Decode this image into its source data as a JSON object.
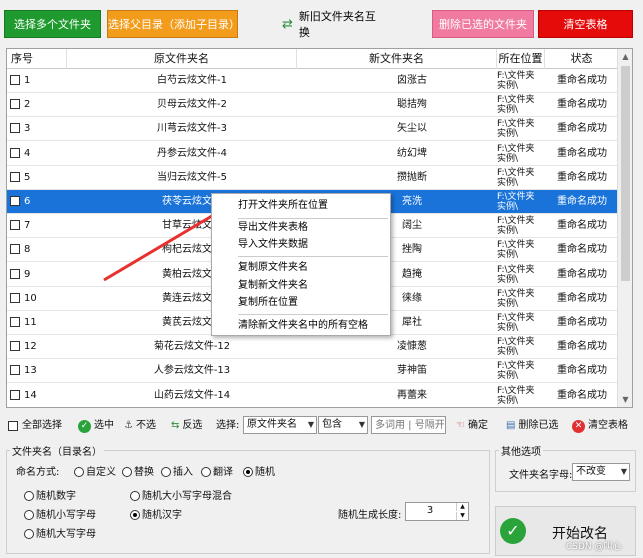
{
  "top_buttons": {
    "select_folders": "选择多个文件夹",
    "select_parent": "选择父目录（添加子目录）",
    "swap": "新旧文件夹名互换",
    "delete_selected": "删除已选的文件夹",
    "clear_table": "清空表格"
  },
  "table": {
    "columns": [
      "序号",
      "原文件夹名",
      "新文件夹名",
      "所在位置",
      "状态"
    ],
    "rows": [
      {
        "idx": "1",
        "old": "白芍云炫文件-1",
        "new": "囟涨古",
        "loc": "F:\\文件夹实例\\",
        "status": "重命名成功"
      },
      {
        "idx": "2",
        "old": "贝母云炫文件-2",
        "new": "聪拮殉",
        "loc": "F:\\文件夹实例\\",
        "status": "重命名成功"
      },
      {
        "idx": "3",
        "old": "川芎云炫文件-3",
        "new": "矢尘以",
        "loc": "F:\\文件夹实例\\",
        "status": "重命名成功"
      },
      {
        "idx": "4",
        "old": "丹参云炫文件-4",
        "new": "纺幻埤",
        "loc": "F:\\文件夹实例\\",
        "status": "重命名成功"
      },
      {
        "idx": "5",
        "old": "当归云炫文件-5",
        "new": "攒抛断",
        "loc": "F:\\文件夹实例\\",
        "status": "重命名成功"
      },
      {
        "idx": "6",
        "old": "茯苓云炫文件",
        "new": "亮洗",
        "loc": "F:\\文件夹实例\\",
        "status": "重命名成功"
      },
      {
        "idx": "7",
        "old": "甘草云炫文件",
        "new": "阔尘",
        "loc": "F:\\文件夹实例\\",
        "status": "重命名成功"
      },
      {
        "idx": "8",
        "old": "枸杞云炫文件",
        "new": "挫陶",
        "loc": "F:\\文件夹实例\\",
        "status": "重命名成功"
      },
      {
        "idx": "9",
        "old": "黄柏云炫文件",
        "new": "趋掩",
        "loc": "F:\\文件夹实例\\",
        "status": "重命名成功"
      },
      {
        "idx": "10",
        "old": "黄连云炫文件",
        "new": "徕缘",
        "loc": "F:\\文件夹实例\\",
        "status": "重命名成功"
      },
      {
        "idx": "11",
        "old": "黄芪云炫文件",
        "new": "犀社",
        "loc": "F:\\文件夹实例\\",
        "status": "重命名成功"
      },
      {
        "idx": "12",
        "old": "菊花云炫文件-12",
        "new": "凌慷葱",
        "loc": "F:\\文件夹实例\\",
        "status": "重命名成功"
      },
      {
        "idx": "13",
        "old": "人参云炫文件-13",
        "new": "芽神笛",
        "loc": "F:\\文件夹实例\\",
        "status": "重命名成功"
      },
      {
        "idx": "14",
        "old": "山药云炫文件-14",
        "new": "再蕾来",
        "loc": "F:\\文件夹实例\\",
        "status": "重命名成功"
      }
    ]
  },
  "context_menu": [
    "打开文件夹所在位置",
    "导出文件夹表格",
    "导入文件夹数据",
    "复制原文件夹名",
    "复制新文件夹名",
    "复制所在位置",
    "清除新文件夹名中的所有空格"
  ],
  "toolbar": {
    "select_all": "全部选择",
    "check": "选中",
    "uncheck": "不选",
    "invert": "反选",
    "select_label": "选择:",
    "field_value": "原文件夹名",
    "op_value": "包含",
    "keyword_placeholder": "多词用 | 号隔开",
    "confirm": "确定",
    "delete_checked": "删除已选",
    "clear": "清空表格"
  },
  "naming": {
    "group_title": "文件夹名（目录名）",
    "mode_label": "命名方式:",
    "modes": [
      "自定义",
      "替换",
      "插入",
      "翻译",
      "随机"
    ],
    "random_opts": [
      "随机数字",
      "随机大小写字母混合",
      "随机小写字母",
      "随机汉字",
      "随机大写字母"
    ],
    "length_label": "随机生成长度:",
    "length_value": "3"
  },
  "other": {
    "group_title": "其他选项",
    "case_label": "文件夹名字母:",
    "case_value": "不改变",
    "start_button": "开始改名",
    "watermark": "CSDN @叫心"
  }
}
